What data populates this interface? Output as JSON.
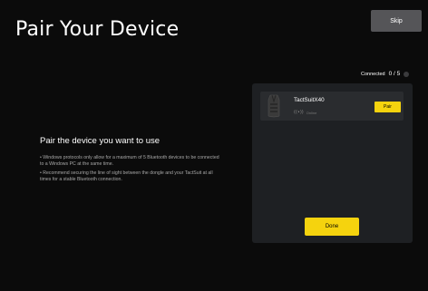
{
  "page": {
    "title": "Pair Your Device",
    "skip_label": "Skip"
  },
  "info": {
    "heading": "Pair the device you want to use",
    "notes": [
      "• Windows protocols only allow for a maximum of 5 Bluetooth devices to be connected to a Windows PC at the same time.",
      "• Recommend securing the line of sight between the dongle and your TactSuit at all times for a stable Bluetooth connection."
    ]
  },
  "status": {
    "connected_label": "Connected",
    "connected_count": "0 / 5",
    "info_icon": "info-icon"
  },
  "devices": [
    {
      "name": "TactSuitX40",
      "status": "Online",
      "signal_icon": "signal-icon",
      "pair_label": "Pair"
    }
  ],
  "actions": {
    "done_label": "Done"
  },
  "colors": {
    "background": "#0b0b0b",
    "panel": "#1e2023",
    "card": "#2a2c2f",
    "accent": "#f5d30e",
    "skip_button": "#555558"
  }
}
